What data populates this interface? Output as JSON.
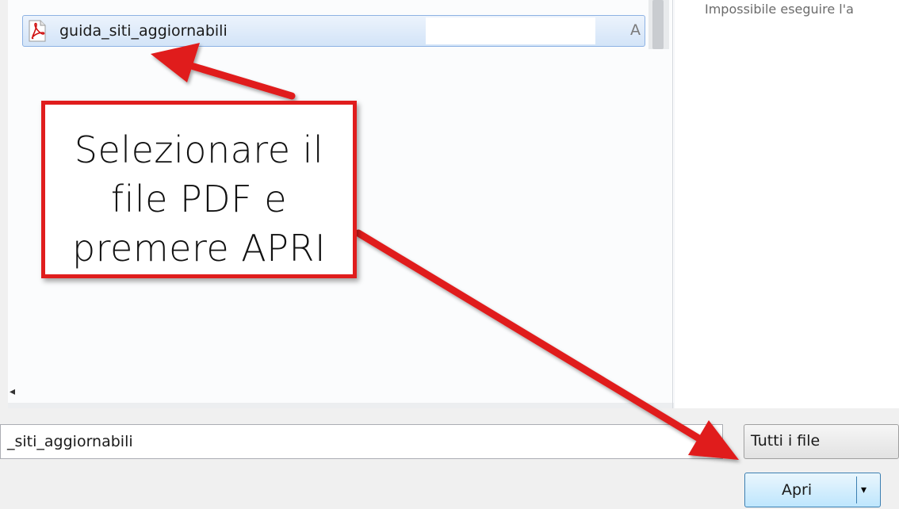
{
  "file_list": {
    "selected_file": {
      "name": "guida_siti_aggiornabili",
      "type_truncated": "A",
      "icon": "pdf-file-icon"
    },
    "scroll_left_glyph": "◂"
  },
  "preview": {
    "message": "Impossibile eseguire l'a"
  },
  "footer": {
    "filename_value": "_siti_aggiornabili",
    "filetype_selected": "Tutti i file",
    "open_button_label": "Apri",
    "open_dropdown_glyph": "▾"
  },
  "annotation": {
    "lines": [
      "Selezionare il",
      "file PDF e",
      "premere APRI"
    ],
    "border_color": "#e01d1d",
    "arrow_color": "#e01d1d"
  }
}
